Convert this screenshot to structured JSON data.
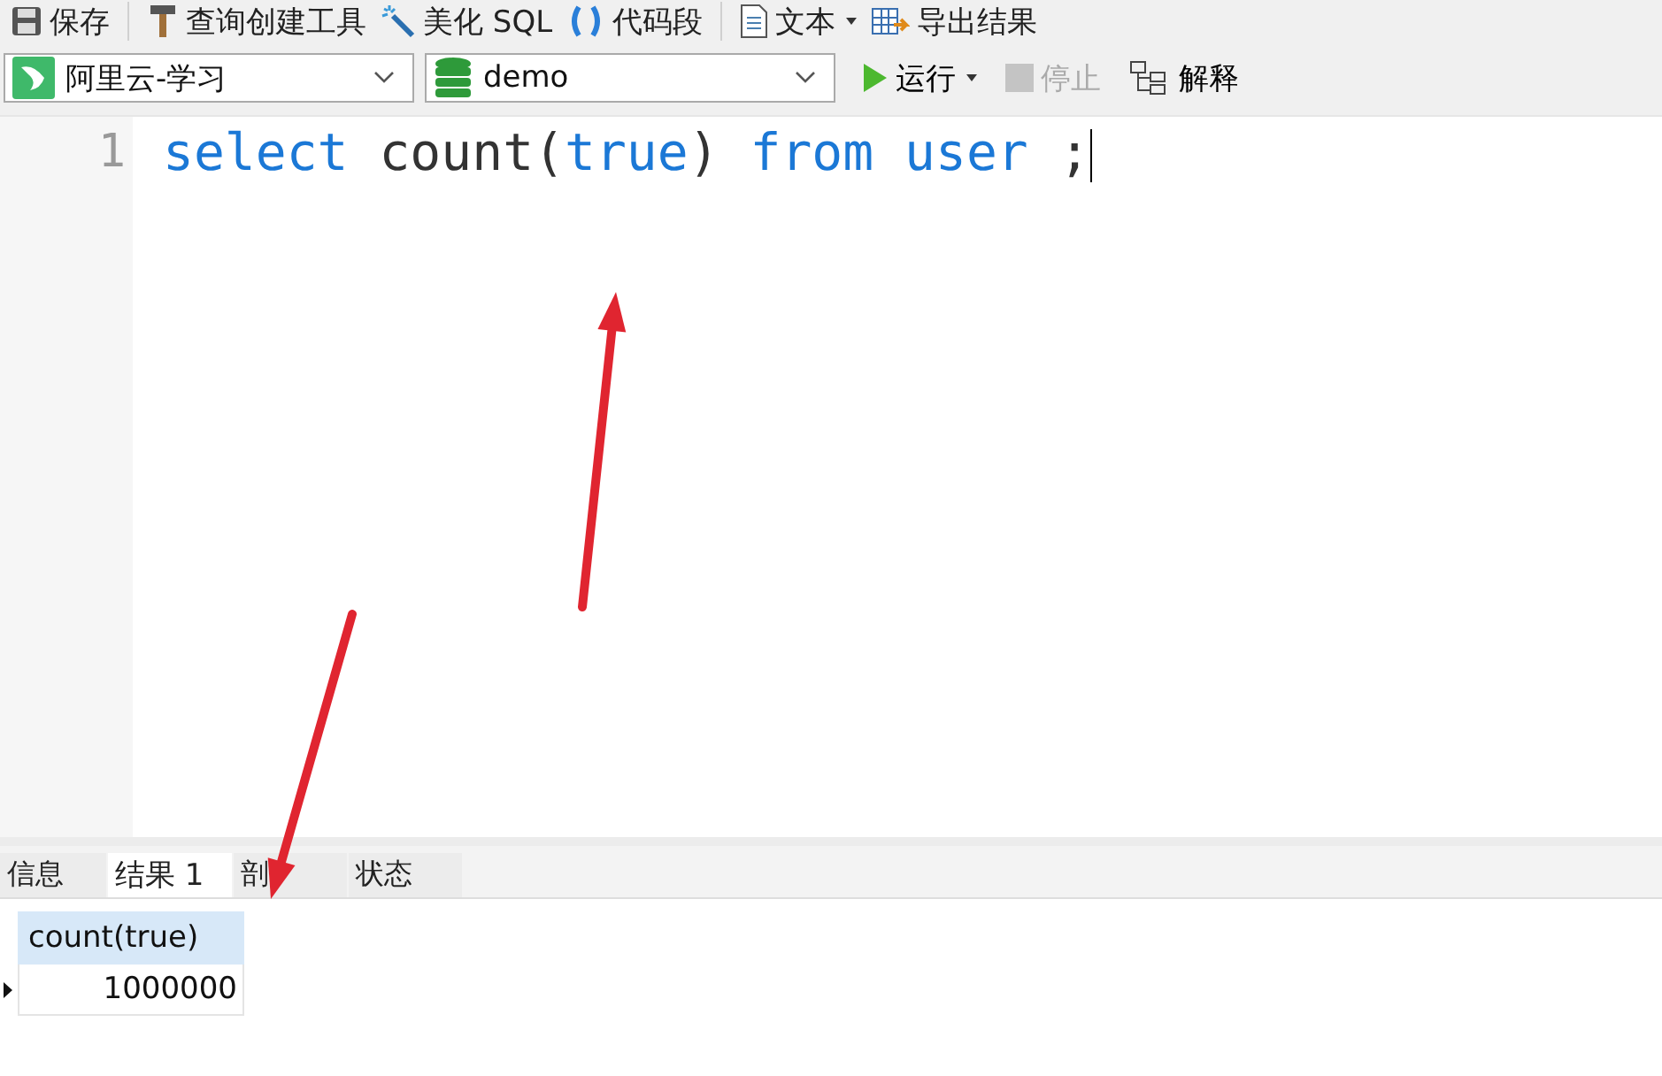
{
  "toolbar": [
    {
      "kind": "save",
      "label": "保存"
    },
    {
      "kind": "sep"
    },
    {
      "kind": "hammer",
      "label": "查询创建工具"
    },
    {
      "kind": "wand",
      "label": "美化 SQL"
    },
    {
      "kind": "braces",
      "label": "代码段"
    },
    {
      "kind": "sep"
    },
    {
      "kind": "doc",
      "label": "文本",
      "dropdown": true
    },
    {
      "kind": "export",
      "label": "导出结果"
    }
  ],
  "connection": {
    "value": "阿里云-学习"
  },
  "database": {
    "value": "demo"
  },
  "actions": [
    {
      "kind": "run",
      "label": "运行",
      "dropdown": true,
      "disabled": false
    },
    {
      "kind": "stop",
      "label": "停止",
      "disabled": true
    },
    {
      "kind": "explain",
      "label": "解释",
      "disabled": false
    }
  ],
  "editor": {
    "lines": [
      {
        "number": "1",
        "tokens": [
          {
            "kind": "keyword",
            "text": "select"
          },
          {
            "kind": "plain",
            "text": " count("
          },
          {
            "kind": "keyword",
            "text": "true"
          },
          {
            "kind": "plain",
            "text": ") "
          },
          {
            "kind": "keyword",
            "text": "from user"
          },
          {
            "kind": "plain",
            "text": " ;"
          }
        ]
      }
    ]
  },
  "result_tabs": [
    {
      "label": "信息",
      "selected": false
    },
    {
      "label": "结果 1",
      "selected": true
    },
    {
      "label": "剖",
      "selected": false
    },
    {
      "label": "状态",
      "selected": false
    }
  ],
  "result_table": {
    "columns": [
      "count(true)"
    ],
    "rows": [
      [
        "1000000"
      ]
    ]
  },
  "annotations": [
    {
      "kind": "arrow"
    },
    {
      "kind": "arrow"
    }
  ]
}
